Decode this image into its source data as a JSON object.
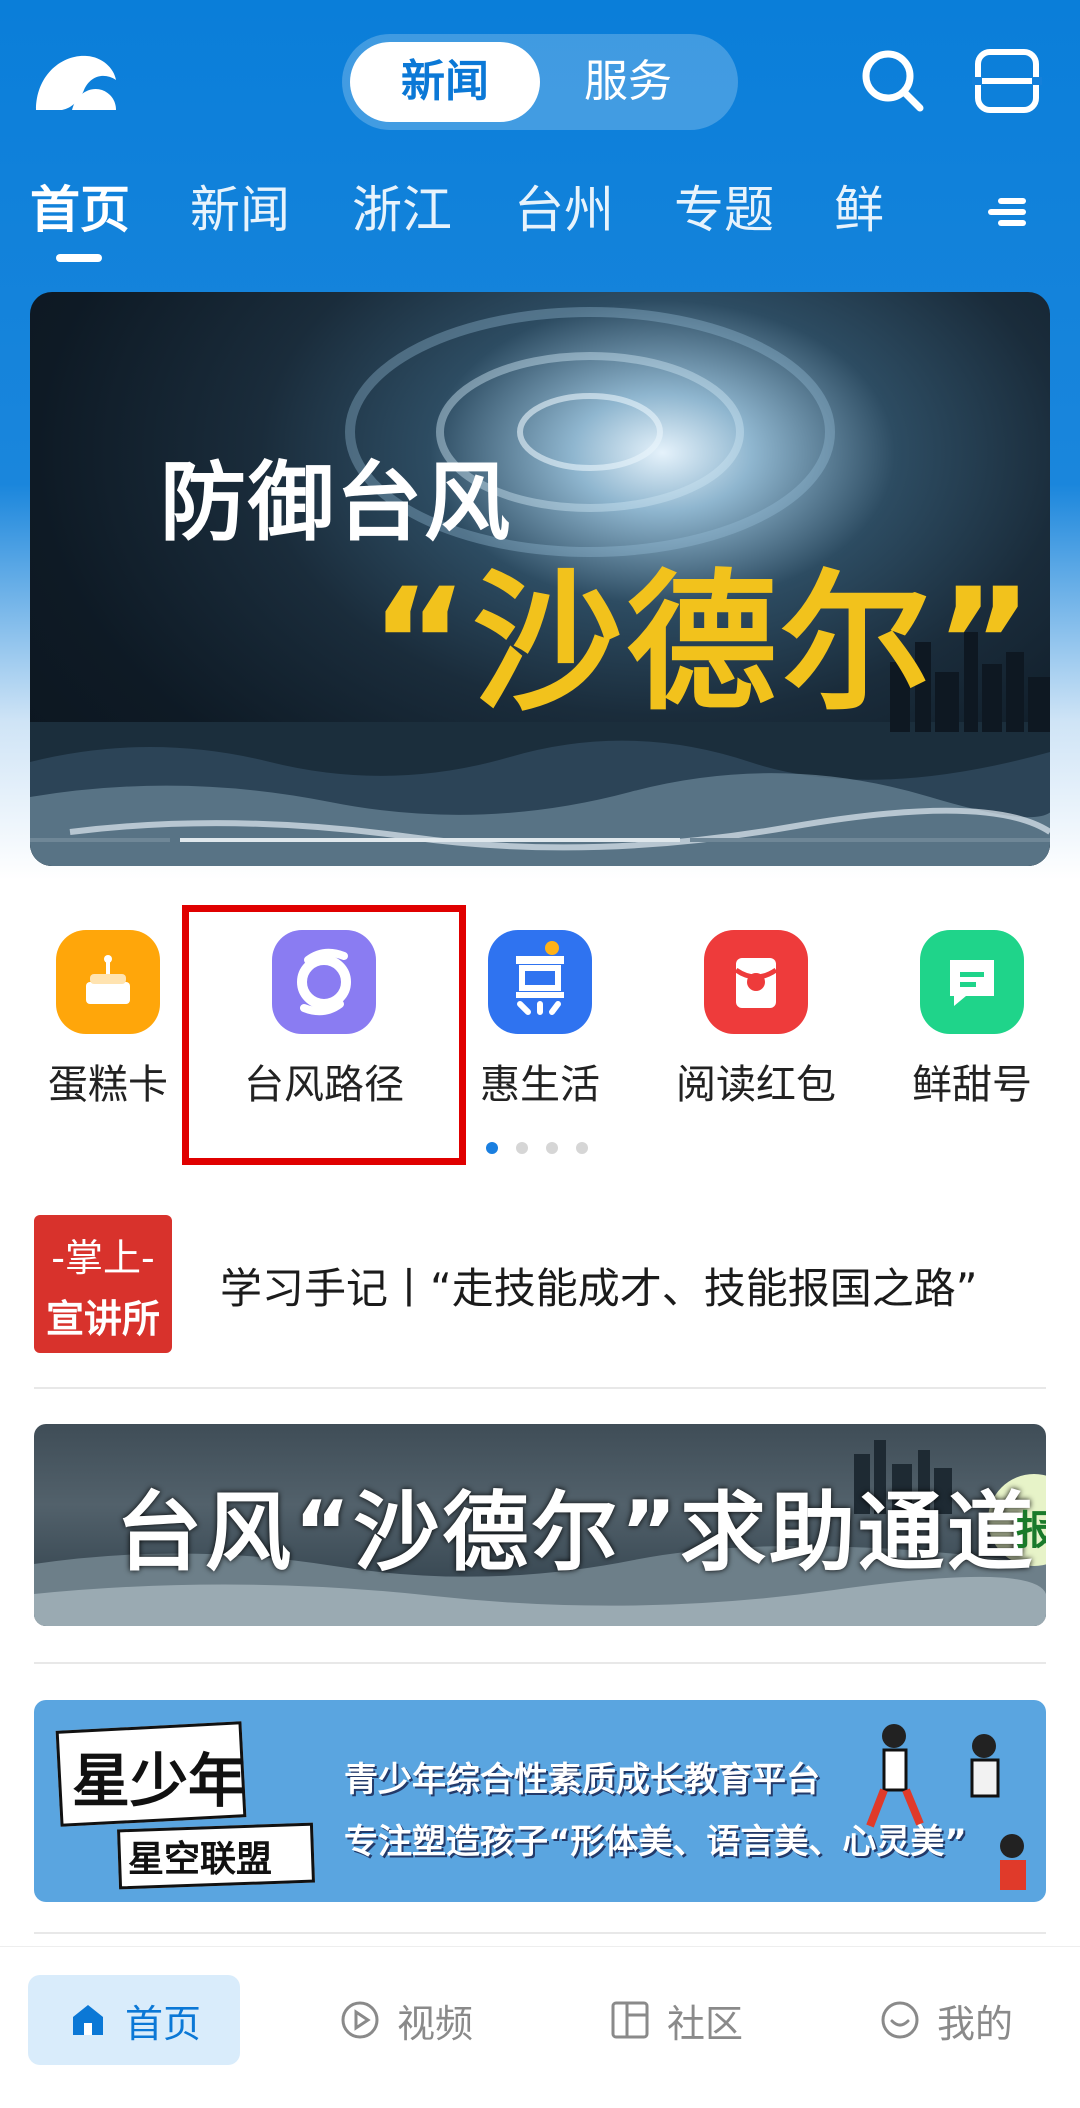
{
  "header": {
    "segment": {
      "active": "新闻",
      "inactive": "服务"
    },
    "icons": [
      "search-icon",
      "menu-icon"
    ]
  },
  "tabs": [
    "首页",
    "新闻",
    "浙江",
    "台州",
    "专题",
    "鲜"
  ],
  "banner": {
    "title_line1": "防御台风",
    "title_line2": "“沙德尔”"
  },
  "quick_links": [
    {
      "label": "蛋糕卡",
      "icon": "cake-icon",
      "color": "#FFA60A"
    },
    {
      "label": "台风路径",
      "icon": "typhoon-icon",
      "color": "#8A7CF2"
    },
    {
      "label": "惠生活",
      "icon": "hui-icon",
      "color": "#2F73F0"
    },
    {
      "label": "阅读红包",
      "icon": "red-packet-icon",
      "color": "#EE3B3B"
    },
    {
      "label": "鲜甜号",
      "icon": "chat-icon",
      "color": "#1FD48A"
    }
  ],
  "news_item": {
    "thumb_line1": "-掌上-",
    "thumb_line2": "宣讲所",
    "title": "学习手记丨“走技能成才、技能报国之路”"
  },
  "banner2": {
    "text": "台风“沙德尔”求助通道",
    "side_text": "报"
  },
  "banner3": {
    "brand_title": "星少年",
    "brand_sub": "星空联盟",
    "line1": "青少年综合性素质成长教育平台",
    "line2": "专注塑造孩子“形体美、语言美、心灵美”"
  },
  "bottom_nav": [
    {
      "label": "首页",
      "icon": "home-icon"
    },
    {
      "label": "视频",
      "icon": "video-icon"
    },
    {
      "label": "社区",
      "icon": "community-icon"
    },
    {
      "label": "我的",
      "icon": "profile-icon"
    }
  ]
}
